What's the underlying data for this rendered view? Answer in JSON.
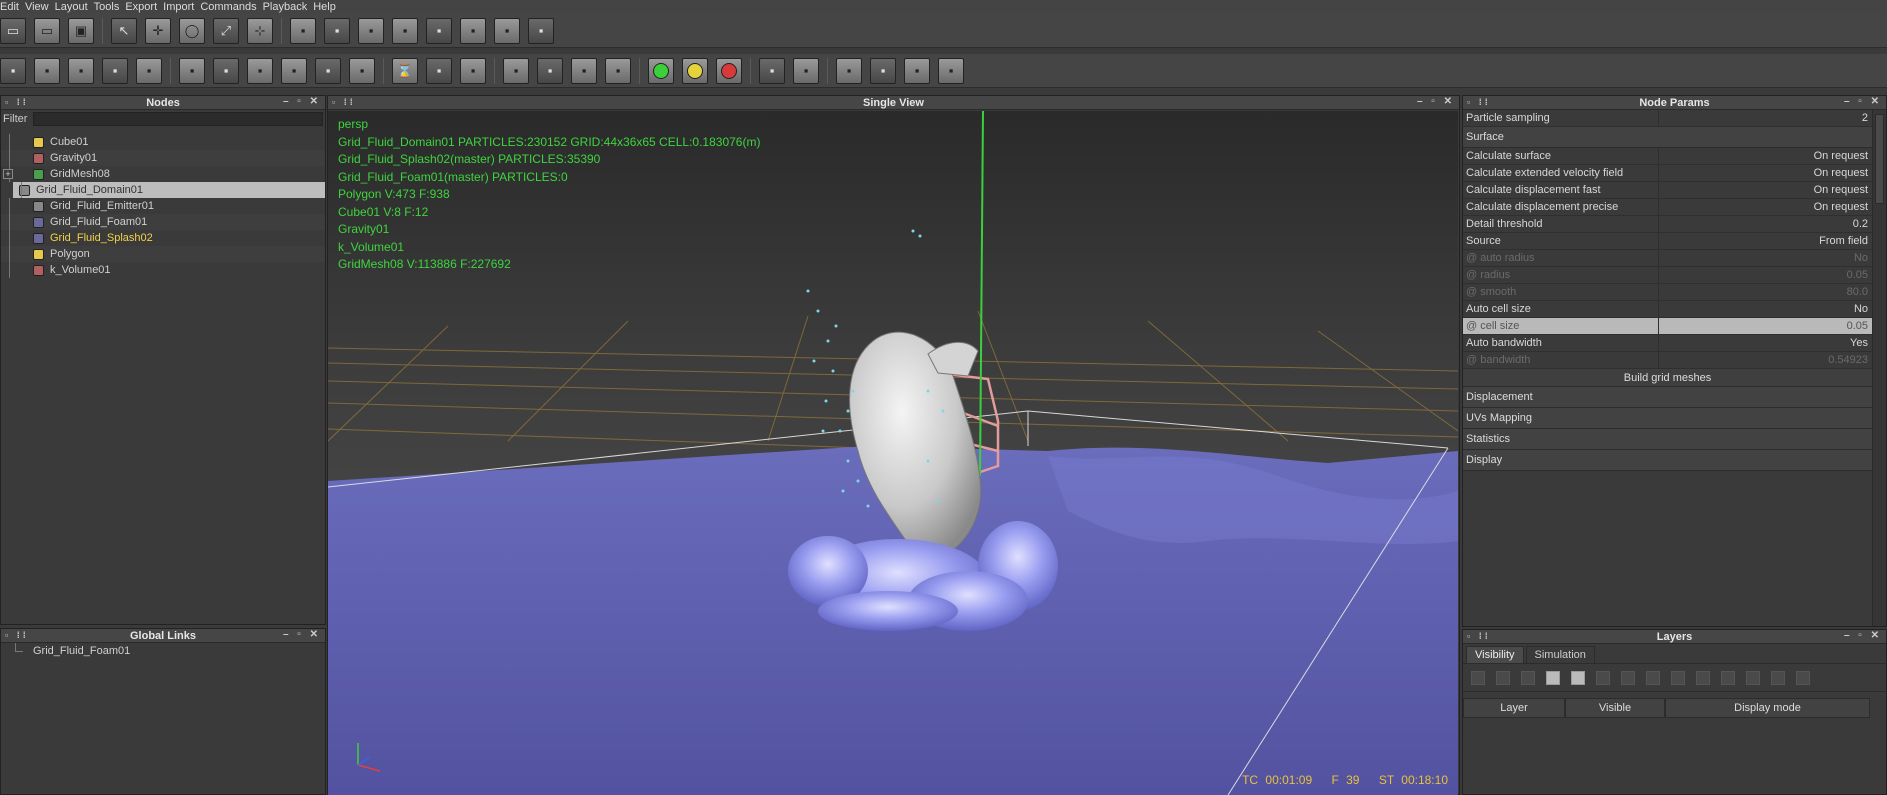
{
  "menu": [
    "Edit",
    "View",
    "Layout",
    "Tools",
    "Export",
    "Import",
    "Commands",
    "Playback",
    "Help"
  ],
  "toolbar1_icons": [
    "new-icon",
    "open-icon",
    "save-icon",
    "select-icon",
    "move-icon",
    "rotate-icon",
    "scale-icon",
    "axis-icon",
    "cube-icon",
    "particles-icon",
    "emitter-icon",
    "box-icon",
    "sphere-icon",
    "camera-icon",
    "fluid-icon",
    "domain-icon"
  ],
  "toolbar2_icons": [
    "tool-a-icon",
    "tool-b-icon",
    "tool-c-icon",
    "tool-d-icon",
    "tool-e-icon",
    "tool-f-icon",
    "tool-g-icon",
    "tool-h-icon",
    "tool-i-icon",
    "tool-j-icon",
    "tool-k-icon",
    "timer-icon",
    "tool-l-icon",
    "tool-m-icon",
    "view-a-icon",
    "view-b-icon",
    "view-c-icon",
    "view-d-icon",
    "play-green-icon",
    "pause-yellow-icon",
    "stop-red-icon",
    "save-sim-icon",
    "delete-sim-icon",
    "render-a-icon",
    "render-b-icon",
    "render-c-icon",
    "render-d-icon"
  ],
  "nodes": {
    "title": "Nodes",
    "filter_label": "Filter",
    "filter_value": "",
    "items": [
      {
        "label": "Cube01",
        "color": "#e6c84a",
        "state": "normal"
      },
      {
        "label": "Gravity01",
        "color": "#b06060",
        "state": "normal"
      },
      {
        "label": "GridMesh08",
        "color": "#4aa04a",
        "state": "normal"
      },
      {
        "label": "Grid_Fluid_Domain01",
        "color": "#888888",
        "state": "selected"
      },
      {
        "label": "Grid_Fluid_Emitter01",
        "color": "#888888",
        "state": "normal"
      },
      {
        "label": "Grid_Fluid_Foam01",
        "color": "#6a6a9a",
        "state": "normal"
      },
      {
        "label": "Grid_Fluid_Splash02",
        "color": "#6a6a9a",
        "state": "highlight"
      },
      {
        "label": "Polygon",
        "color": "#e6c84a",
        "state": "normal"
      },
      {
        "label": "k_Volume01",
        "color": "#b06060",
        "state": "normal"
      }
    ]
  },
  "global_links": {
    "title": "Global Links",
    "items": [
      "Grid_Fluid_Foam01"
    ]
  },
  "viewport": {
    "title": "Single View",
    "hud": [
      "persp",
      "Grid_Fluid_Domain01 PARTICLES:230152 GRID:44x36x65 CELL:0.183076(m)",
      "Grid_Fluid_Splash02(master) PARTICLES:35390",
      "Grid_Fluid_Foam01(master) PARTICLES:0",
      "Polygon V:473 F:938",
      "Cube01 V:8 F:12",
      "Gravity01",
      "k_Volume01",
      "GridMesh08 V:113886 F:227692"
    ],
    "tc": "TC 00:01:09",
    "frame": "F 39",
    "st": "ST 00:18:10"
  },
  "params": {
    "title": "Node Params",
    "top_row": {
      "k": "Particle sampling",
      "v": "2"
    },
    "surface_label": "Surface",
    "rows": [
      {
        "k": "Calculate surface",
        "v": "On request",
        "state": "normal"
      },
      {
        "k": "Calculate extended velocity field",
        "v": "On request",
        "state": "normal"
      },
      {
        "k": "Calculate displacement fast",
        "v": "On request",
        "state": "normal"
      },
      {
        "k": "Calculate displacement precise",
        "v": "On request",
        "state": "normal"
      },
      {
        "k": "Detail threshold",
        "v": "0.2",
        "state": "normal"
      },
      {
        "k": "Source",
        "v": "From field",
        "state": "normal"
      },
      {
        "k": "@ auto radius",
        "v": "No",
        "state": "dim"
      },
      {
        "k": "@ radius",
        "v": "0.05",
        "state": "dim"
      },
      {
        "k": "@ smooth",
        "v": "80.0",
        "state": "dim"
      },
      {
        "k": "Auto cell size",
        "v": "No",
        "state": "normal"
      },
      {
        "k": "@ cell size",
        "v": "0.05",
        "state": "selected"
      },
      {
        "k": "Auto bandwidth",
        "v": "Yes",
        "state": "normal"
      },
      {
        "k": "@ bandwidth",
        "v": "0.54923",
        "state": "dim"
      }
    ],
    "build_button": "Build grid meshes",
    "sections": [
      "Displacement",
      "UVs Mapping",
      "Statistics",
      "Display"
    ]
  },
  "layers": {
    "title": "Layers",
    "tabs": [
      "Visibility",
      "Simulation"
    ],
    "columns": [
      "Layer",
      "Visible",
      "Display mode"
    ]
  }
}
